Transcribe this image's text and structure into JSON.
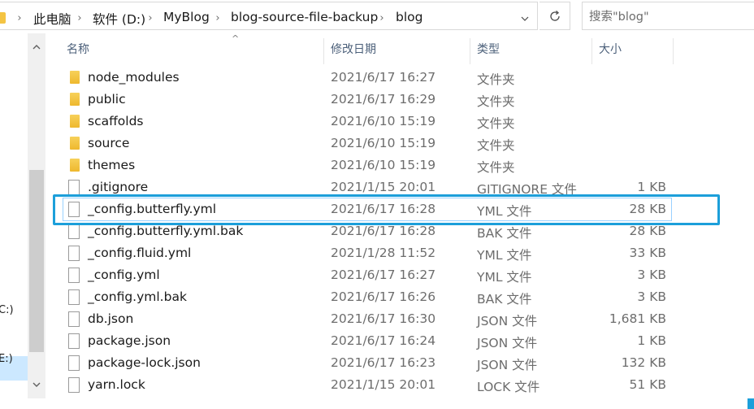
{
  "address_bar": {
    "crumbs": [
      "此电脑",
      "软件 (D:)",
      "MyBlog",
      "blog-source-file-backup",
      "blog"
    ]
  },
  "search": {
    "placeholder": "搜索\"blog\""
  },
  "nav_pane": {
    "labels": [
      "C:)",
      "E:)"
    ]
  },
  "columns": {
    "name": "名称",
    "date": "修改日期",
    "type": "类型",
    "size": "大小"
  },
  "files": [
    {
      "name": "node_modules",
      "date": "2021/6/17 16:27",
      "type": "文件夹",
      "size": "",
      "kind": "folder"
    },
    {
      "name": "public",
      "date": "2021/6/17 16:29",
      "type": "文件夹",
      "size": "",
      "kind": "folder"
    },
    {
      "name": "scaffolds",
      "date": "2021/6/10 15:19",
      "type": "文件夹",
      "size": "",
      "kind": "folder"
    },
    {
      "name": "source",
      "date": "2021/6/10 15:19",
      "type": "文件夹",
      "size": "",
      "kind": "folder"
    },
    {
      "name": "themes",
      "date": "2021/6/10 15:19",
      "type": "文件夹",
      "size": "",
      "kind": "folder"
    },
    {
      "name": ".gitignore",
      "date": "2021/1/15 20:01",
      "type": "GITIGNORE 文件",
      "size": "1 KB",
      "kind": "file"
    },
    {
      "name": "_config.butterfly.yml",
      "date": "2021/6/17 16:28",
      "type": "YML 文件",
      "size": "28 KB",
      "kind": "file",
      "selected": true
    },
    {
      "name": "_config.butterfly.yml.bak",
      "date": "2021/6/17 16:28",
      "type": "BAK 文件",
      "size": "28 KB",
      "kind": "file"
    },
    {
      "name": "_config.fluid.yml",
      "date": "2021/1/28 11:52",
      "type": "YML 文件",
      "size": "33 KB",
      "kind": "file"
    },
    {
      "name": "_config.yml",
      "date": "2021/6/17 16:27",
      "type": "YML 文件",
      "size": "3 KB",
      "kind": "file"
    },
    {
      "name": "_config.yml.bak",
      "date": "2021/6/17 16:26",
      "type": "BAK 文件",
      "size": "3 KB",
      "kind": "file"
    },
    {
      "name": "db.json",
      "date": "2021/6/17 16:30",
      "type": "JSON 文件",
      "size": "1,681 KB",
      "kind": "file"
    },
    {
      "name": "package.json",
      "date": "2021/6/17 16:24",
      "type": "JSON 文件",
      "size": "1 KB",
      "kind": "file"
    },
    {
      "name": "package-lock.json",
      "date": "2021/6/17 16:23",
      "type": "JSON 文件",
      "size": "132 KB",
      "kind": "file"
    },
    {
      "name": "yarn.lock",
      "date": "2021/1/15 20:01",
      "type": "LOCK 文件",
      "size": "51 KB",
      "kind": "file"
    }
  ],
  "colors": {
    "highlight": "#1c9fda",
    "folder": "#f4c443",
    "selection": "#cce8ff"
  },
  "icons": {
    "folder": "folder-icon",
    "file": "file-icon",
    "refresh": "refresh-icon",
    "chevron": "chevron-right-icon"
  }
}
